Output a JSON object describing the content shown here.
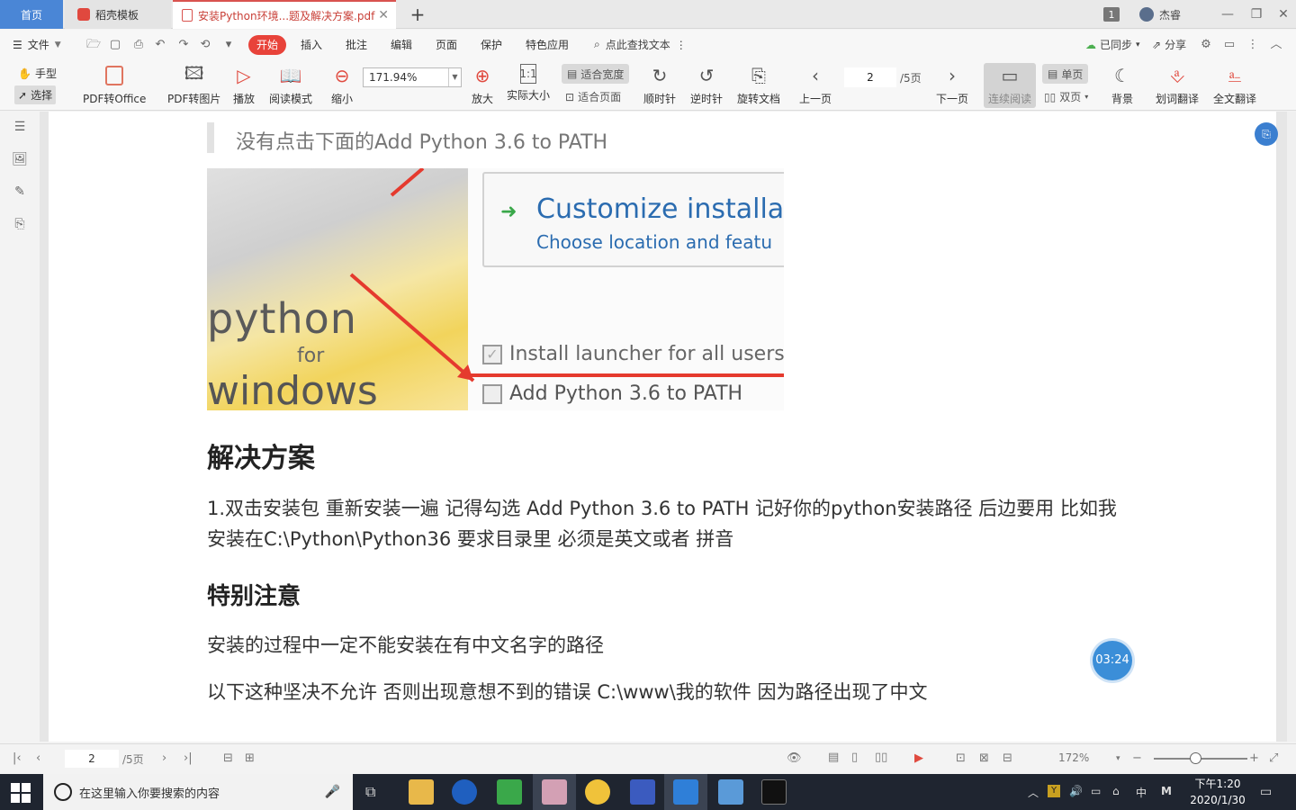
{
  "tabs": {
    "home": "首页",
    "template": "稻壳模板",
    "document": "安装Python环境...题及解决方案.pdf"
  },
  "titlebar": {
    "badge": "1",
    "user": "杰睿"
  },
  "menu": {
    "file": "文件",
    "items": [
      "开始",
      "插入",
      "批注",
      "编辑",
      "页面",
      "保护",
      "特色应用"
    ],
    "search": "点此查找文本",
    "sync": "已同步",
    "share": "分享"
  },
  "ribbon": {
    "hand": "手型",
    "select": "选择",
    "pdf_to_office": "PDF转Office",
    "pdf_to_image": "PDF转图片",
    "play": "播放",
    "read_mode": "阅读模式",
    "zoom_out": "缩小",
    "zoom_value": "171.94%",
    "zoom_in": "放大",
    "actual_size": "实际大小",
    "fit_width": "适合宽度",
    "fit_page": "适合页面",
    "rotate_cw": "顺时针",
    "rotate_ccw": "逆时针",
    "rotate_doc": "旋转文档",
    "prev_page": "上一页",
    "page_current": "2",
    "page_total": "/5页",
    "next_page": "下一页",
    "continuous": "连续阅读",
    "single": "单页",
    "double": "双页",
    "background": "背景",
    "word_translate": "划词翻译",
    "full_translate": "全文翻译"
  },
  "document": {
    "quote": "没有点击下面的Add Python 3.6 to PATH",
    "screenshot": {
      "brand": "python",
      "for": "for",
      "windows": "windows",
      "title": "Customize installatio",
      "subtitle": "Choose location and featu",
      "option1": "Install launcher for all users",
      "option2": "Add Python 3.6 to PATH"
    },
    "heading1": "解决方案",
    "para1": "1.双击安装包 重新安装一遍 记得勾选 Add Python 3.6 to PATH 记好你的python安装路径 后边要用 比如我安装在C:\\Python\\Python36 要求目录里 必须是英文或者 拼音",
    "heading2": "特别注意",
    "para2": "安装的过程中一定不能安装在有中文名字的路径",
    "para3": "以下这种坚决不允许 否则出现意想不到的错误 C:\\www\\我的软件 因为路径出现了中文"
  },
  "timer": "03:24",
  "statusbar": {
    "page": "2",
    "total": "/5页",
    "zoom": "172%"
  },
  "taskbar": {
    "search_placeholder": "在这里输入你要搜索的内容",
    "ime": "中",
    "ime2": "M",
    "time": "下午1:20",
    "date": "2020/1/30"
  }
}
